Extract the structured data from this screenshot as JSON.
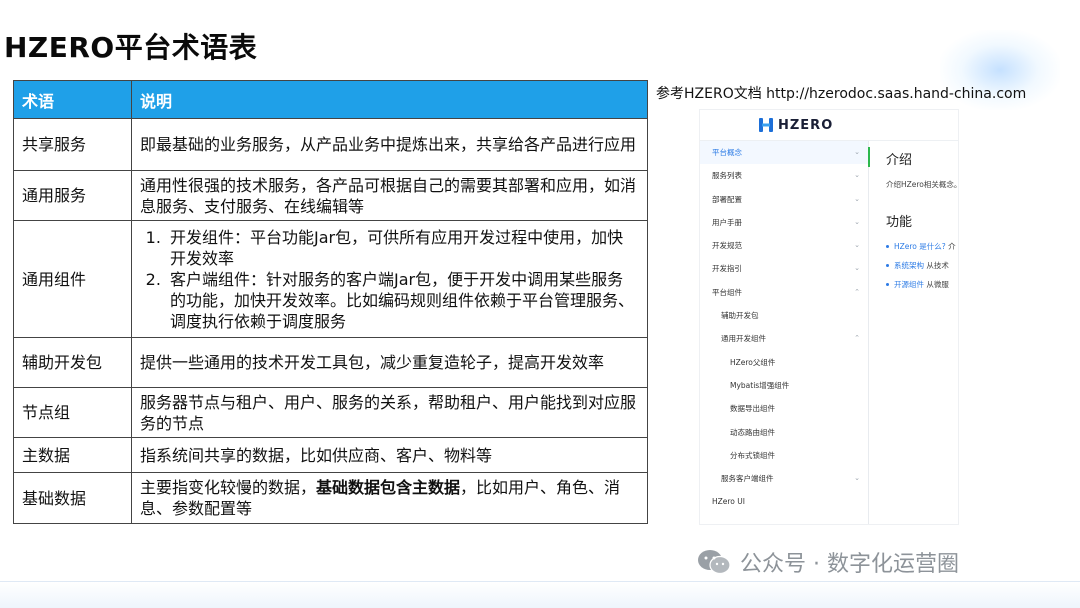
{
  "slide": {
    "title": "HZERO平台术语表"
  },
  "table": {
    "headers": [
      "术语",
      "说明"
    ],
    "rows": [
      {
        "term": "共享服务",
        "desc": "即最基础的业务服务，从产品业务中提炼出来，共享给各产品进行应用"
      },
      {
        "term": "通用服务",
        "desc": "通用性很强的技术服务，各产品可根据自己的需要其部署和应用，如消息服务、支付服务、在线编辑等"
      },
      {
        "term": "通用组件",
        "items": [
          "开发组件：平台功能Jar包，可供所有应用开发过程中使用，加快开发效率",
          "客户端组件：针对服务的客户端Jar包，便于开发中调用某些服务的功能，加快开发效率。比如编码规则组件依赖于平台管理服务、调度执行依赖于调度服务"
        ]
      },
      {
        "term": "辅助开发包",
        "desc": "提供一些通用的技术开发工具包，减少重复造轮子，提高开发效率"
      },
      {
        "term": "节点组",
        "desc": "服务器节点与租户、用户、服务的关系，帮助租户、用户能找到对应服务的节点"
      },
      {
        "term": "主数据",
        "desc": "指系统间共享的数据，比如供应商、客户、物料等"
      },
      {
        "term": "基础数据",
        "desc_a": "主要指变化较慢的数据，",
        "desc_bold": "基础数据包含主数据",
        "desc_b": "，比如用户、角色、消息、参数配置等"
      }
    ]
  },
  "reference": {
    "caption": "参考HZERO文档 http://hzerodoc.saas.hand-china.com"
  },
  "doc_screenshot": {
    "logo_text": "HZERO",
    "sidebar": [
      {
        "label": "平台概念",
        "chevron": "⌄"
      },
      {
        "label": "服务列表",
        "chevron": "⌄"
      },
      {
        "label": "部署配置",
        "chevron": "⌄"
      },
      {
        "label": "用户手册",
        "chevron": "⌄"
      },
      {
        "label": "开发规范",
        "chevron": "⌄"
      },
      {
        "label": "开发指引",
        "chevron": "⌄"
      },
      {
        "label": "平台组件",
        "chevron": "⌃"
      },
      {
        "label": "辅助开发包",
        "chevron": ""
      },
      {
        "label": "通用开发组件",
        "chevron": "⌃"
      },
      {
        "label": "HZero父组件",
        "chevron": ""
      },
      {
        "label": "Mybatis增强组件",
        "chevron": ""
      },
      {
        "label": "数据导出组件",
        "chevron": ""
      },
      {
        "label": "动态路由组件",
        "chevron": ""
      },
      {
        "label": "分布式锁组件",
        "chevron": ""
      },
      {
        "label": "服务客户端组件",
        "chevron": "⌄"
      },
      {
        "label": "HZero UI",
        "chevron": ""
      }
    ],
    "content": {
      "heading": "介绍",
      "intro": "介绍HZero相关概念。",
      "section": "功能",
      "links": [
        {
          "link": "HZero 是什么?",
          "text": " 介"
        },
        {
          "link": "系统架构",
          "text": " 从技术"
        },
        {
          "link": "开源组件",
          "text": " 从微服"
        }
      ]
    }
  },
  "watermark": {
    "text": "公众号 · 数字化运营圈"
  },
  "colors": {
    "header_bg": "#1fa0e8",
    "link": "#2c7be5",
    "active_bar": "#2db84d"
  }
}
